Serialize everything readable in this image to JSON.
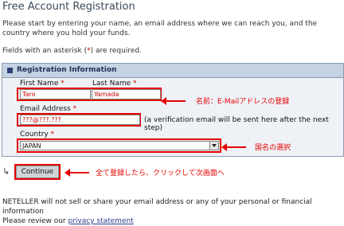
{
  "page": {
    "title": "Free Account Registration",
    "intro": "Please start by entering your name, an email address where we can reach you, and the country where you hold your funds.",
    "required_prefix": "Fields with an asterisk (",
    "asterisk": "*",
    "required_suffix": ") are required."
  },
  "panel": {
    "heading": "Registration Information"
  },
  "form": {
    "first_name_label": "First Name",
    "first_name_value": "Taro",
    "last_name_label": "Last Name",
    "last_name_value": "Yamada",
    "email_label": "Email Address",
    "email_value": "???@???.???",
    "email_note": "(a verification email will be sent here after the next step)",
    "country_label": "Country",
    "country_value": "JAPAN",
    "continue_label": "Continue"
  },
  "annotations": {
    "name_email": "名前：E-Mailアドレスの登録",
    "country": "国名の選択",
    "continue": "全て登録したら、クリックして次画面へ"
  },
  "footer": {
    "line1": "NETELLER will not sell or share your email address or any of your personal or financial information",
    "line2_prefix": "Please review our",
    "privacy_link": "privacy statement"
  },
  "colors": {
    "annotation_red": "#e60000",
    "panel_bg": "#e2e9f1",
    "panel_header": "#c4d2e1"
  }
}
